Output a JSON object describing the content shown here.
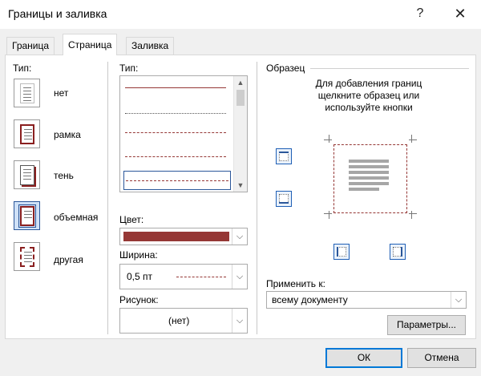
{
  "window": {
    "title": "Границы и заливка",
    "help": "?",
    "close": "✕"
  },
  "tabs": [
    {
      "label": "Граница"
    },
    {
      "label": "Страница"
    },
    {
      "label": "Заливка"
    }
  ],
  "setting": {
    "label": "Тип:",
    "options": [
      {
        "label": "нет"
      },
      {
        "label": "рамка"
      },
      {
        "label": "тень"
      },
      {
        "label": "объемная"
      },
      {
        "label": "другая"
      }
    ],
    "selected": "объемная"
  },
  "style": {
    "label": "Тип:",
    "selected_index": 4
  },
  "color": {
    "label": "Цвет:",
    "value_color": "#953735"
  },
  "width": {
    "label": "Ширина:",
    "value": "0,5 пт"
  },
  "art": {
    "label": "Рисунок:",
    "value": "(нет)"
  },
  "preview": {
    "label": "Образец",
    "hint_line1": "Для добавления границ",
    "hint_line2": "щелкните образец или",
    "hint_line3": "используйте кнопки",
    "border_color": "#953735"
  },
  "apply_to": {
    "label": "Применить к:",
    "value": "всему документу"
  },
  "buttons": {
    "options": "Параметры...",
    "ok": "ОК",
    "cancel": "Отмена"
  },
  "colors": {
    "accent": "#2b579a",
    "border_red": "#953735"
  }
}
